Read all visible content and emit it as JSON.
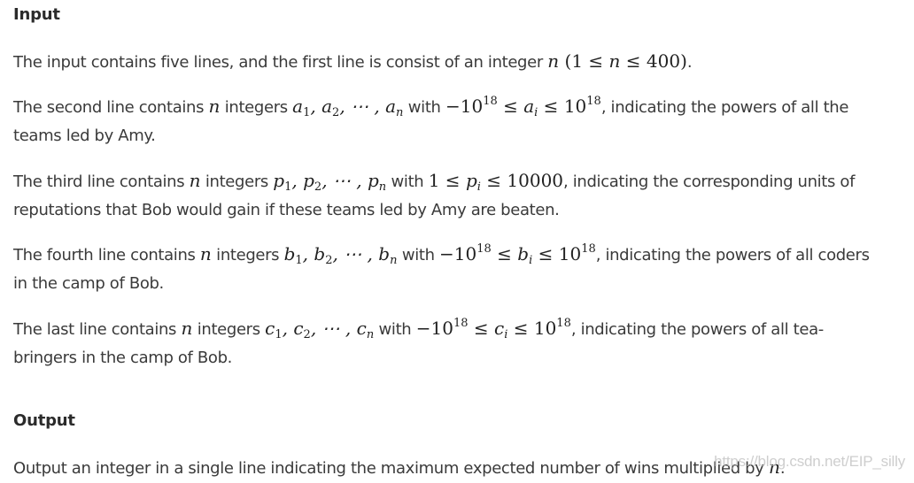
{
  "input_section": {
    "heading": "Input",
    "p1": {
      "text_a": "The input contains five lines, and the first line is consist of an integer ",
      "var_n": "n",
      "math_open": " (1 ≤ ",
      "math_n": "n",
      "math_close": " ≤ 400)",
      "end": "."
    },
    "p2": {
      "text_a": "The second line contains ",
      "var_n": "n",
      "text_b": " integers ",
      "seq_var": "a",
      "seq_1": "1",
      "seq_2": "2",
      "seq_n": "n",
      "dots": ", ⋯ ,",
      "comma": ",",
      "text_with": " with ",
      "bound_low": "−10",
      "exp": "18",
      "leq": " ≤ ",
      "var_i_base": "a",
      "var_i_sub": "i",
      "bound_high": "10",
      "text_c": ", indicating the powers of all the",
      "line2": "teams led by Amy."
    },
    "p3": {
      "text_a": "The third line contains ",
      "var_n": "n",
      "text_b": " integers ",
      "seq_var": "p",
      "seq_1": "1",
      "seq_2": "2",
      "seq_n": "n",
      "dots": ", ⋯ ,",
      "comma": ",",
      "text_with": " with ",
      "bound_low": "1",
      "leq": " ≤ ",
      "var_i_base": "p",
      "var_i_sub": "i",
      "bound_high": "10000",
      "text_c": ", indicating the corresponding units of",
      "line2": "reputations that Bob would gain if these teams led by Amy are beaten."
    },
    "p4": {
      "text_a": "The fourth line contains ",
      "var_n": "n",
      "text_b": " integers ",
      "seq_var": "b",
      "seq_1": "1",
      "seq_2": "2",
      "seq_n": "n",
      "dots": ", ⋯ ,",
      "comma": ",",
      "text_with": " with ",
      "bound_low": "−10",
      "exp": "18",
      "leq": " ≤ ",
      "var_i_base": "b",
      "var_i_sub": "i",
      "bound_high": "10",
      "text_c": ", indicating the powers of all coders",
      "line2": "in the camp of Bob."
    },
    "p5": {
      "text_a": "The last line contains ",
      "var_n": "n",
      "text_b": " integers ",
      "seq_var": "c",
      "seq_1": "1",
      "seq_2": "2",
      "seq_n": "n",
      "dots": ", ⋯ ,",
      "comma": ",",
      "text_with": " with ",
      "bound_low": "−10",
      "exp": "18",
      "leq": " ≤ ",
      "var_i_base": "c",
      "var_i_sub": "i",
      "bound_high": "10",
      "text_c": ", indicating the powers of all tea-",
      "line2": "bringers in the camp of Bob."
    }
  },
  "output_section": {
    "heading": "Output",
    "p1": {
      "text_a": "Output an integer in a single line indicating the maximum expected number of wins multiplied by ",
      "var_n": "n",
      "end": "."
    }
  },
  "watermark": "https://blog.csdn.net/EIP_silly"
}
